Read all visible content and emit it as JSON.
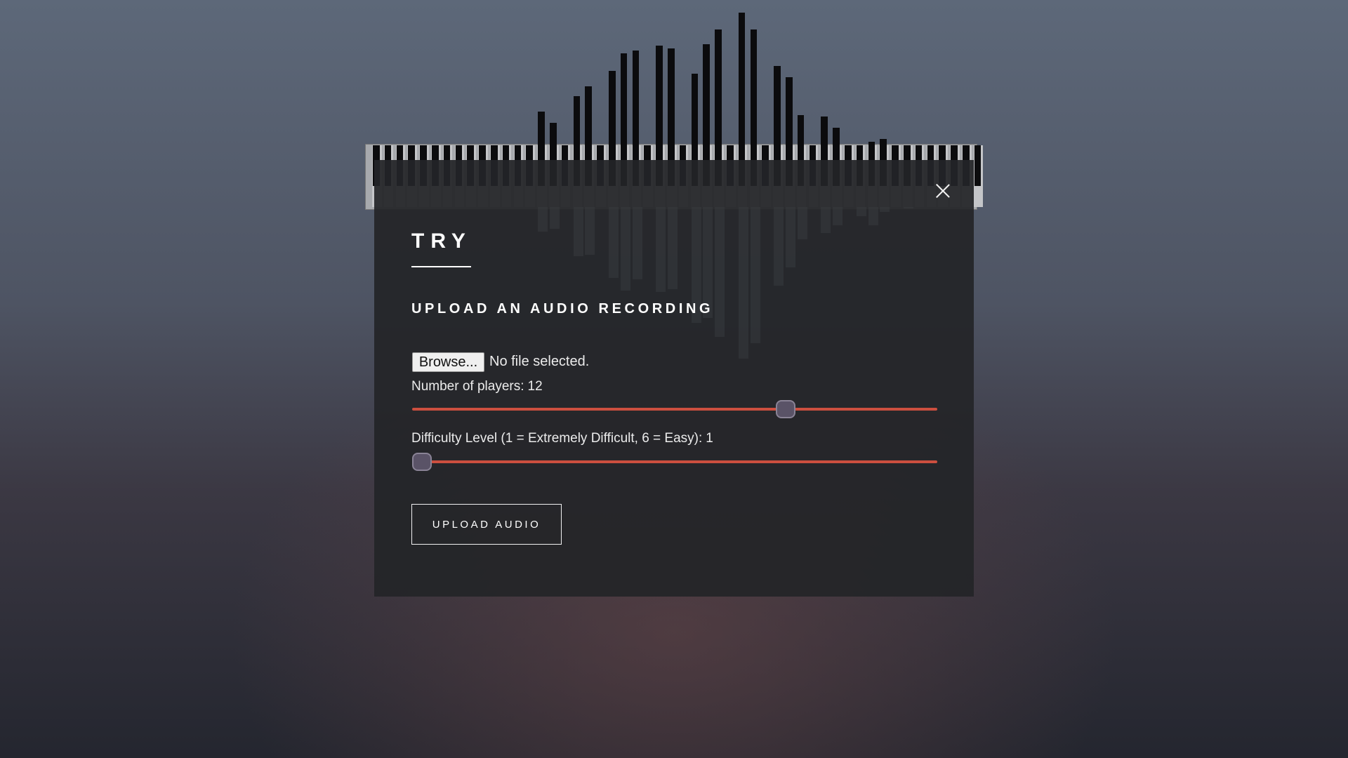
{
  "modal": {
    "close_icon": "close-icon",
    "title": "TRY",
    "subtitle": "UPLOAD AN AUDIO RECORDING",
    "file_input": {
      "button_label": "Browse...",
      "status": "No file selected."
    },
    "players": {
      "label": "Number of players:",
      "value": "12",
      "slider_fraction": 0.72
    },
    "difficulty": {
      "label": "Difficulty Level (1 = Extremely Difficult, 6 = Easy):",
      "value": "1",
      "slider_fraction": 0.0
    },
    "upload_button": "UPLOAD AUDIO"
  },
  "theme": {
    "accent": "#cc4f3f",
    "thumb": "#5a5367",
    "panel": "#242528"
  },
  "background": {
    "visual": "piano-keyboard-with-audio-bars",
    "bar_levels_up": [
      0.02,
      0.02,
      0.02,
      0.02,
      0.02,
      0.02,
      0.02,
      0.02,
      0.02,
      0.02,
      0.02,
      0.02,
      0.02,
      0.02,
      0.47,
      0.4,
      0.02,
      0.57,
      0.63,
      0.02,
      0.73,
      0.84,
      0.86,
      0.02,
      0.89,
      0.87,
      0.02,
      0.71,
      0.9,
      0.99,
      0.02,
      1.1,
      0.99,
      0.02,
      0.76,
      0.69,
      0.45,
      0.02,
      0.44,
      0.37,
      0.02,
      0.25,
      0.28,
      0.3,
      0.02,
      0.25,
      0.02,
      0.02,
      0.02,
      0.02,
      0.02,
      0.02
    ],
    "bar_levels_down": [
      0.0,
      0.0,
      0.0,
      0.0,
      0.0,
      0.0,
      0.0,
      0.0,
      0.0,
      0.0,
      0.0,
      0.0,
      0.0,
      0.0,
      0.16,
      0.14,
      0.0,
      0.32,
      0.31,
      0.0,
      0.46,
      0.54,
      0.47,
      0.0,
      0.55,
      0.53,
      0.0,
      0.75,
      0.72,
      0.84,
      0.0,
      0.98,
      0.88,
      0.0,
      0.51,
      0.39,
      0.21,
      0.0,
      0.17,
      0.12,
      0.0,
      0.06,
      0.12,
      0.03,
      0.0,
      0.01,
      0.0,
      0.0,
      0.0,
      0.0,
      0.0,
      0.0
    ]
  }
}
